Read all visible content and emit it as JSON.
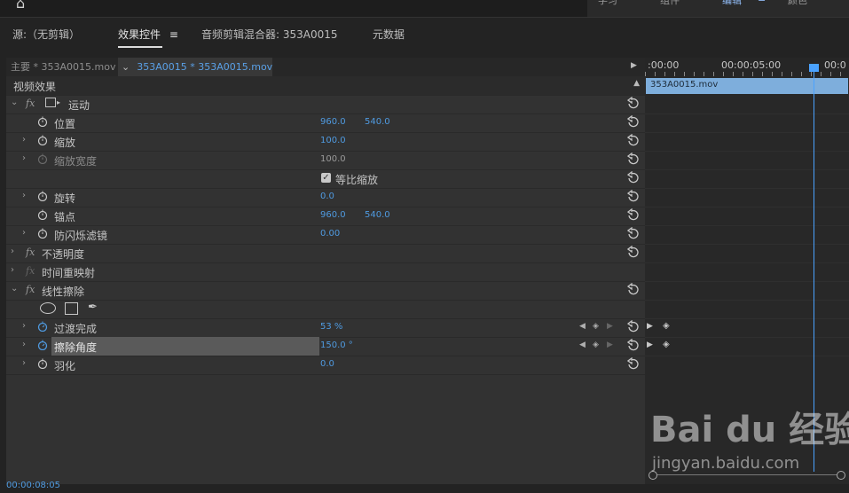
{
  "topbar": {
    "modes": [
      "学习",
      "组件",
      "编辑",
      "颜色"
    ],
    "active_mode": "编辑"
  },
  "panel_tabs": {
    "source": "源:（无剪辑）",
    "effect_controls": "效果控件",
    "audio_mixer": "音频剪辑混合器: 353A0015",
    "metadata": "元数据"
  },
  "sequence": {
    "master": "主要 * 353A0015.mov",
    "active": "353A0015 * 353A0015.mov"
  },
  "effects": {
    "header": "视频效果",
    "motion": {
      "name": "运动",
      "position": {
        "label": "位置",
        "x": "960.0",
        "y": "540.0"
      },
      "scale": {
        "label": "缩放",
        "value": "100.0"
      },
      "scale_width": {
        "label": "缩放宽度",
        "value": "100.0"
      },
      "uniform_scale": {
        "label": "等比缩放"
      },
      "rotation": {
        "label": "旋转",
        "value": "0.0"
      },
      "anchor": {
        "label": "锚点",
        "x": "960.0",
        "y": "540.0"
      },
      "anti_flicker": {
        "label": "防闪烁滤镜",
        "value": "0.00"
      }
    },
    "opacity": "不透明度",
    "time_remap": "时间重映射",
    "linear_wipe": {
      "name": "线性擦除",
      "transition": {
        "label": "过渡完成",
        "value": "53 %"
      },
      "angle": {
        "label": "擦除角度",
        "value": "150.0 °"
      },
      "feather": {
        "label": "羽化",
        "value": "0.0"
      }
    }
  },
  "timeline": {
    "timecodes": [
      ":00:00",
      "00:00:05:00",
      "00:0"
    ],
    "clip": "353A0015.mov"
  },
  "current_time": "00:00:08:05",
  "watermark": {
    "logo": "Bai du 经验",
    "url": "jingyan.baidu.com"
  },
  "colors": {
    "accent": "#4f9ae0",
    "clip": "#7eaedc",
    "playhead": "#4aa2ff"
  }
}
